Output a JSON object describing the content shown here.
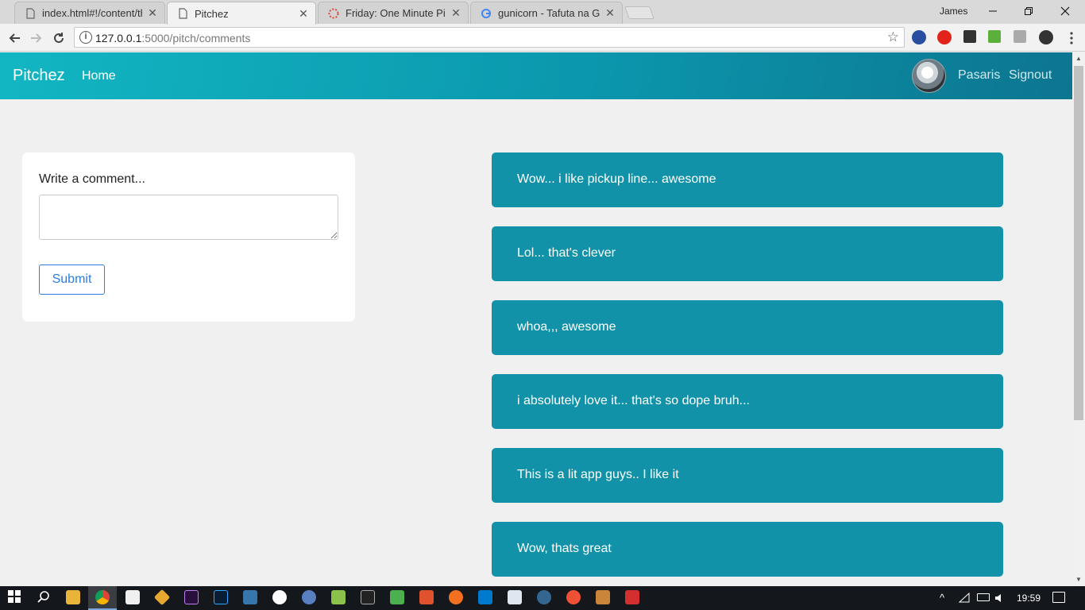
{
  "browser": {
    "tabs": [
      {
        "title": "index.html#!/content/thu",
        "active": false
      },
      {
        "title": "Pitchez",
        "active": true
      },
      {
        "title": "Friday: One Minute Pitch",
        "active": false
      },
      {
        "title": "gunicorn - Tafuta na Goo",
        "active": false
      }
    ],
    "profile_name": "James",
    "url_host": "127.0.0.1",
    "url_rest": ":5000/pitch/comments",
    "close_glyph": "✕"
  },
  "app": {
    "brand": "Pitchez",
    "nav_home": "Home",
    "user_name": "Pasaris",
    "signout": "Signout",
    "accent_color": "#1192a8"
  },
  "comment_form": {
    "label": "Write a comment...",
    "textarea_value": "",
    "submit_label": "Submit"
  },
  "comments": [
    "Wow... i like pickup line... awesome",
    "Lol... that's clever",
    "whoa,,, awesome",
    "i absolutely love it... that's so dope bruh...",
    "This is a lit app guys.. I like it",
    "Wow, thats great"
  ],
  "taskbar": {
    "clock": "19:59"
  }
}
